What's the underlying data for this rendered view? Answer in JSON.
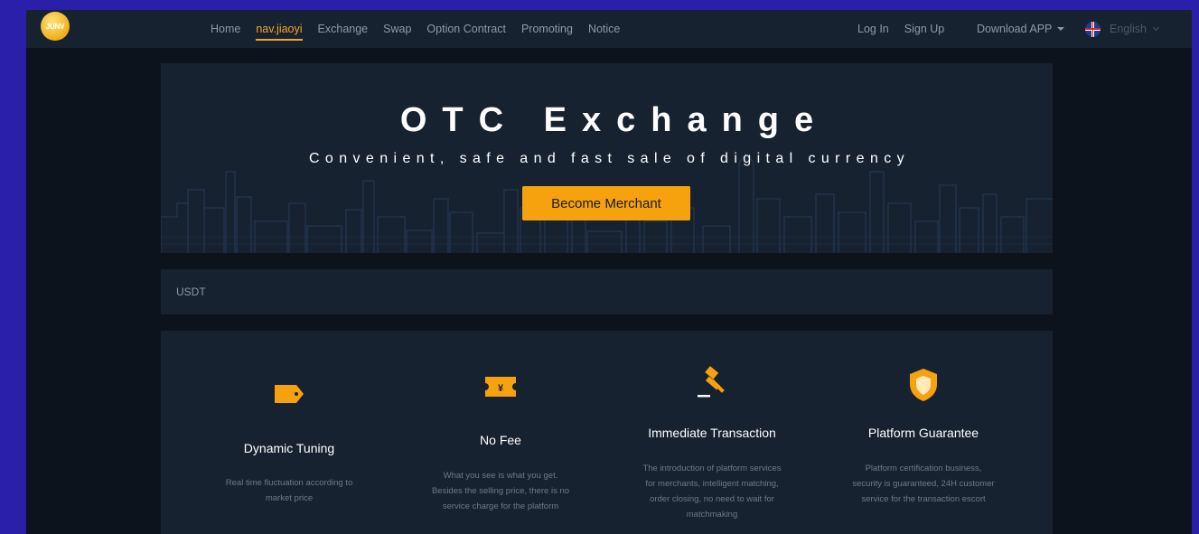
{
  "nav": {
    "logo_text": "JUNV",
    "links": [
      "Home",
      "nav.jiaoyi",
      "Exchange",
      "Swap",
      "Option Contract",
      "Promoting",
      "Notice"
    ],
    "active_index": 1,
    "login": "Log In",
    "signup": "Sign Up",
    "download": "Download APP",
    "language": "English"
  },
  "hero": {
    "title": "OTC Exchange",
    "subtitle": "Convenient, safe and fast sale of digital currency",
    "cta": "Become Merchant"
  },
  "coin_tabs": [
    "USDT"
  ],
  "features": [
    {
      "icon": "tag-icon",
      "title": "Dynamic Tuning",
      "desc": "Real time fluctuation according to market price"
    },
    {
      "icon": "ticket-yen-icon",
      "title": "No Fee",
      "desc": "What you see is what you get. Besides the selling price, there is no service charge for the platform"
    },
    {
      "icon": "gavel-icon",
      "title": "Immediate Transaction",
      "desc": "The introduction of platform services for merchants, intelligent matching, order closing, no need to wait for matchmaking"
    },
    {
      "icon": "shield-icon",
      "title": "Platform Guarantee",
      "desc": "Platform certification business, security is guaranteed, 24H customer service for the transaction escort"
    }
  ],
  "colors": {
    "accent": "#f5a20e",
    "panel": "#172230",
    "background": "#0c131d",
    "outer": "#2a1fa8"
  }
}
